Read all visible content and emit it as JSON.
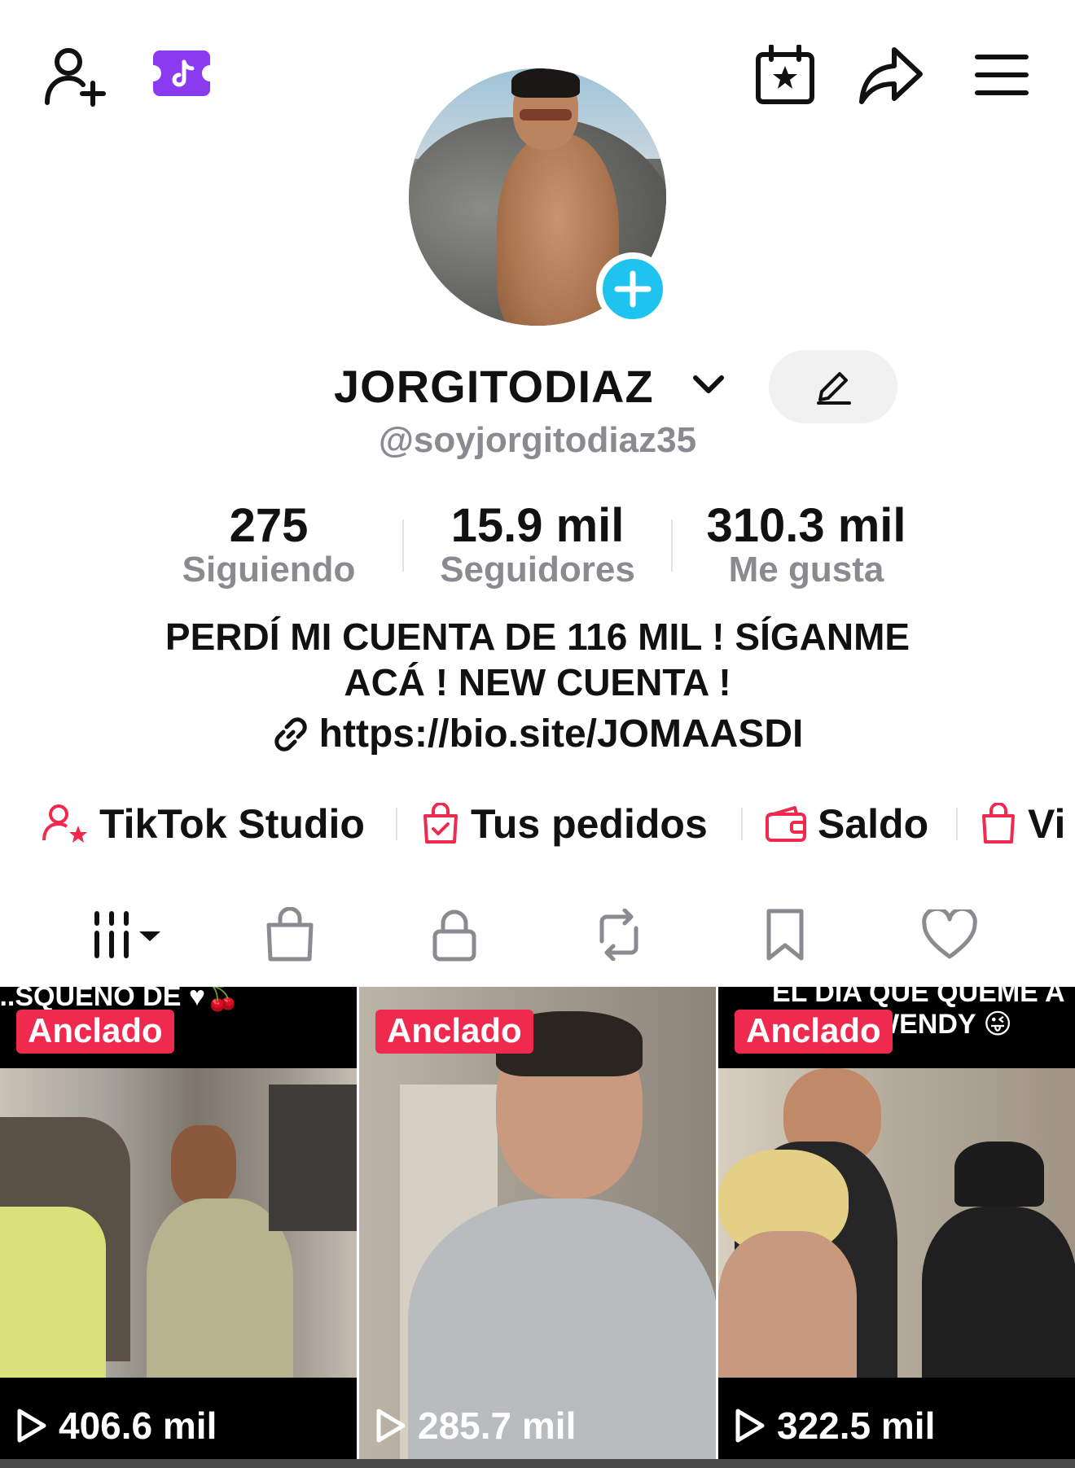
{
  "header": {
    "add_friend_icon": "person-plus-icon",
    "live_ticket_icon": "tiktok-ticket-icon",
    "calendar_icon": "calendar-star-icon",
    "share_icon": "share-arrow-icon",
    "menu_icon": "hamburger-menu-icon"
  },
  "profile": {
    "display_name": "JORGITODIAZ",
    "handle": "@soyjorgitodiaz35",
    "bio": "PERDÍ MI CUENTA DE 116 MIL ! SÍGANME ACÁ ! NEW CUENTA !",
    "link": "https://bio.site/JOMAASDI"
  },
  "stats": [
    {
      "value": "275",
      "label": "Siguiendo"
    },
    {
      "value": "15.9 mil",
      "label": "Seguidores"
    },
    {
      "value": "310.3 mil",
      "label": "Me gusta"
    }
  ],
  "shortcuts": [
    {
      "label": "TikTok Studio",
      "icon": "creator-star-icon"
    },
    {
      "label": "Tus pedidos",
      "icon": "orders-bag-icon"
    },
    {
      "label": "Saldo",
      "icon": "wallet-icon"
    },
    {
      "label": "Vi",
      "icon": "shopping-bag-icon"
    }
  ],
  "tabs": [
    {
      "icon": "videos-grid-icon"
    },
    {
      "icon": "shop-bag-icon"
    },
    {
      "icon": "lock-icon"
    },
    {
      "icon": "repost-icon"
    },
    {
      "icon": "bookmark-icon"
    },
    {
      "icon": "heart-icon"
    }
  ],
  "videos": [
    {
      "badge": "Anclado",
      "views": "406.6 mil",
      "caption": "...SQUENO DE ♥🍒"
    },
    {
      "badge": "Anclado",
      "views": "285.7 mil",
      "caption": ""
    },
    {
      "badge": "Anclado",
      "views": "322.5 mil",
      "caption": "EL DIA QUE QUEME A",
      "caption2": "WENDY 😜"
    }
  ],
  "colors": {
    "accent_red": "#f0294f",
    "accent_cyan": "#1fc3ef",
    "accent_purple": "#8a3bf0",
    "muted_text": "#8a8b91"
  }
}
